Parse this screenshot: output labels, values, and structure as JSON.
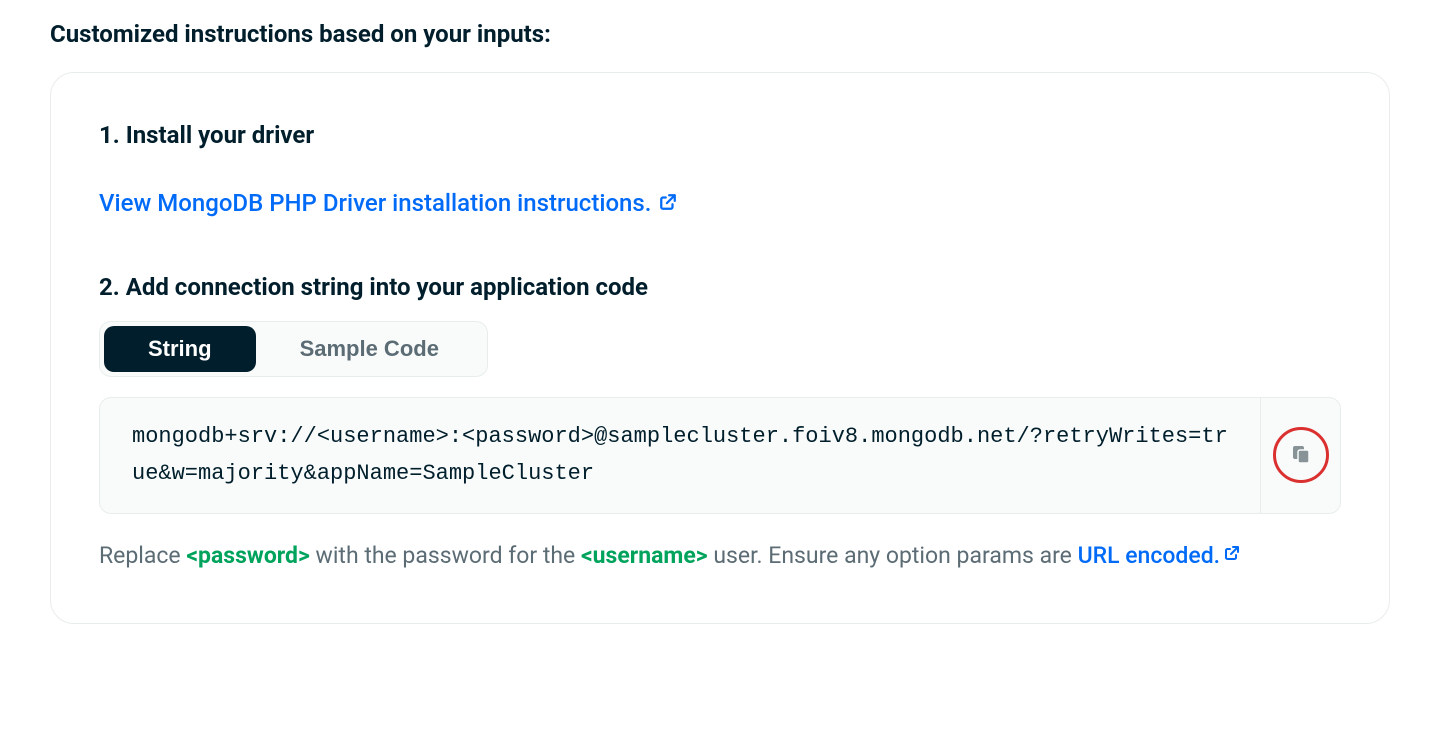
{
  "heading": "Customized instructions based on your inputs:",
  "step1": {
    "title": "1. Install your driver",
    "linkText": "View MongoDB PHP Driver installation instructions."
  },
  "step2": {
    "title": "2. Add connection string into your application code",
    "tabs": {
      "string": "String",
      "sample": "Sample Code"
    },
    "connectionString": "mongodb+srv://<username>:<password>@samplecluster.foiv8.mongodb.net/?retryWrites=true&w=majority&appName=SampleCluster"
  },
  "hint": {
    "prefix": "Replace ",
    "passwordToken": "<password>",
    "mid1": " with the password for the ",
    "usernameToken": "<username>",
    "mid2": " user. Ensure any option params are ",
    "urlEncoded": "URL encoded."
  }
}
